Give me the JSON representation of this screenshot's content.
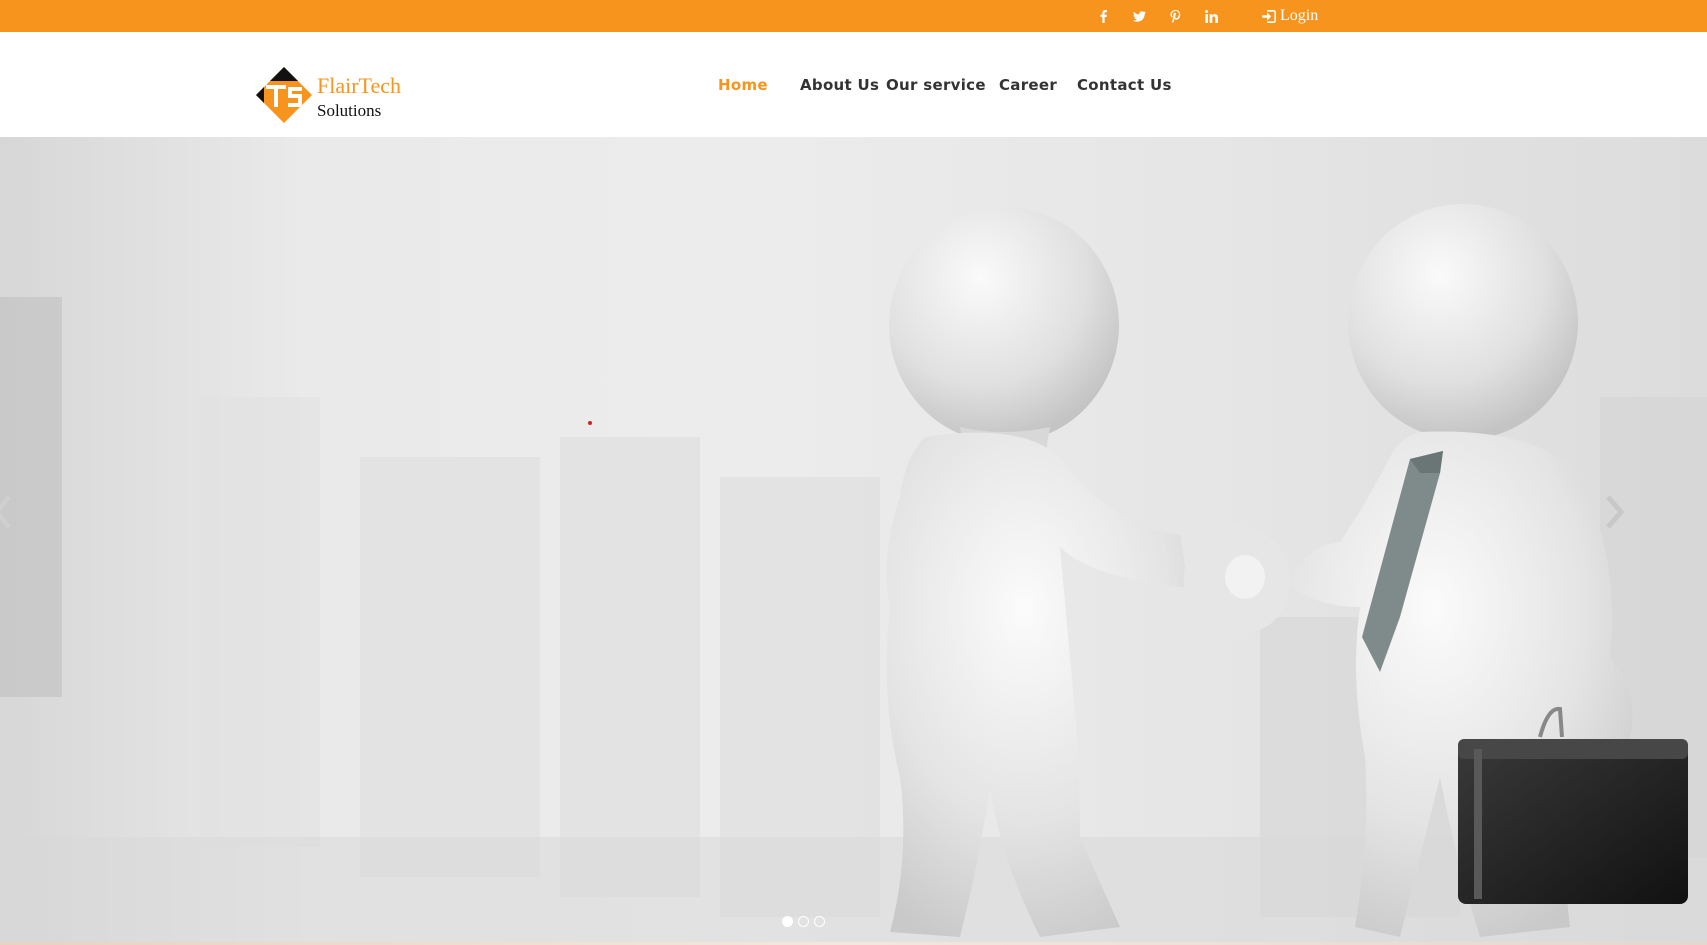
{
  "topbar": {
    "background": "#f7941d",
    "social_icons": [
      {
        "name": "facebook-icon",
        "glyph": "f"
      },
      {
        "name": "twitter-icon",
        "glyph": "t"
      },
      {
        "name": "pinterest-icon",
        "glyph": "p"
      },
      {
        "name": "linkedin-icon",
        "glyph": "in"
      }
    ],
    "login_label": "Login",
    "login_icon": "sign-in-icon"
  },
  "header": {
    "logo_name": "FlairTech",
    "logo_sub": "Solutions",
    "nav": [
      {
        "label": "Home",
        "active": true
      },
      {
        "label": "About Us",
        "active": false
      },
      {
        "label": "Our service",
        "active": false
      },
      {
        "label": "Career",
        "active": false
      },
      {
        "label": "Contact Us",
        "active": false
      }
    ]
  },
  "hero": {
    "image": "handshake-figures",
    "slide_count": 3,
    "active_slide": 1,
    "prev_icon": "chevron-left-icon",
    "next_icon": "chevron-right-icon"
  },
  "colors": {
    "accent": "#f7941d",
    "nav_text": "#333333",
    "white": "#ffffff"
  }
}
